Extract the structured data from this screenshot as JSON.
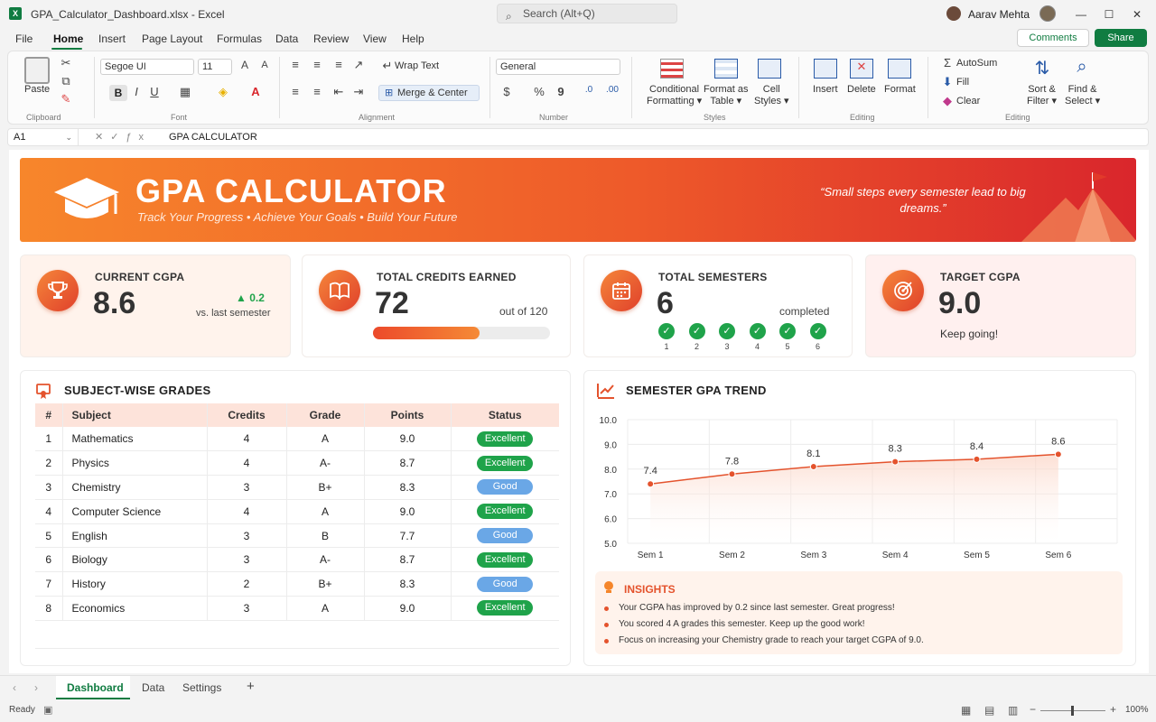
{
  "window": {
    "title": "GPA_Calculator_Dashboard.xlsx - Excel",
    "search_placeholder": "Search (Alt+Q)",
    "user": "Aarav Mehta"
  },
  "menu": {
    "items": [
      "File",
      "Home",
      "Insert",
      "Page Layout",
      "Formulas",
      "Data",
      "Review",
      "View",
      "Help"
    ],
    "active": "Home",
    "comments": "Comments",
    "share": "Share"
  },
  "ribbon": {
    "clipboard": {
      "paste": "Paste",
      "label": "Clipboard"
    },
    "font": {
      "name": "Segoe UI",
      "size": "11",
      "label": "Font"
    },
    "alignment": {
      "wrap": "Wrap Text",
      "merge": "Merge & Center",
      "label": "Alignment"
    },
    "number": {
      "format": "General",
      "label": "Number"
    },
    "styles": {
      "conditional": [
        "Conditional",
        "Formatting ▾"
      ],
      "format_table": [
        "Format as",
        "Table ▾"
      ],
      "cell_styles": [
        "Cell",
        "Styles ▾"
      ],
      "label": "Styles"
    },
    "cells": {
      "insert": "Insert",
      "delete": "Delete",
      "format": "Format",
      "label": "Editing"
    },
    "editing": {
      "autosum": "AutoSum",
      "fill": "Fill",
      "clear": "Clear",
      "sort": [
        "Sort &",
        "Filter ▾"
      ],
      "find": [
        "Find &",
        "Select ▾"
      ],
      "label": "Editing"
    }
  },
  "formula_bar": {
    "cell": "A1",
    "content": "GPA CALCULATOR"
  },
  "banner": {
    "title": "GPA CALCULATOR",
    "subtitle": "Track Your Progress  •  Achieve Your Goals  •  Build Your Future",
    "quote": "“Small steps every semester lead to big dreams.”"
  },
  "cards": {
    "cgpa": {
      "title": "CURRENT CGPA",
      "value": "8.6",
      "delta": "▲ 0.2",
      "delta_note": "vs. last semester",
      "icon": "trophy-icon"
    },
    "credits": {
      "title": "TOTAL CREDITS EARNED",
      "value": "72",
      "note": "out of 120",
      "progress": 0.6,
      "icon": "book-icon"
    },
    "semesters": {
      "title": "TOTAL SEMESTERS",
      "value": "6",
      "note": "completed",
      "steps": [
        "1",
        "2",
        "3",
        "4",
        "5",
        "6"
      ],
      "icon": "calendar-icon"
    },
    "target": {
      "title": "TARGET CGPA",
      "value": "9.0",
      "note": "Keep going!",
      "icon": "target-icon"
    }
  },
  "grades": {
    "title": "SUBJECT-WISE GRADES",
    "headers": [
      "#",
      "Subject",
      "Credits",
      "Grade",
      "Points",
      "Status"
    ],
    "rows": [
      [
        "1",
        "Mathematics",
        "4",
        "A",
        "9.0",
        "Excellent"
      ],
      [
        "2",
        "Physics",
        "4",
        "A-",
        "8.7",
        "Excellent"
      ],
      [
        "3",
        "Chemistry",
        "3",
        "B+",
        "8.3",
        "Good"
      ],
      [
        "4",
        "Computer Science",
        "4",
        "A",
        "9.0",
        "Excellent"
      ],
      [
        "5",
        "English",
        "3",
        "B",
        "7.7",
        "Good"
      ],
      [
        "6",
        "Biology",
        "3",
        "A-",
        "8.7",
        "Excellent"
      ],
      [
        "7",
        "History",
        "2",
        "B+",
        "8.3",
        "Good"
      ],
      [
        "8",
        "Economics",
        "3",
        "A",
        "9.0",
        "Excellent"
      ]
    ]
  },
  "status_colors": {
    "Excellent": "#1fa34a",
    "Good": "#6aa7e6"
  },
  "chart_data": {
    "type": "line",
    "title": "SEMESTER GPA TREND",
    "categories": [
      "Sem 1",
      "Sem 2",
      "Sem 3",
      "Sem 4",
      "Sem 5",
      "Sem 6"
    ],
    "values": [
      7.4,
      7.8,
      8.1,
      8.3,
      8.4,
      8.6
    ],
    "ylim": [
      5.0,
      10.0
    ],
    "yticks": [
      "10.0",
      "9.0",
      "8.0",
      "7.0",
      "6.0",
      "5.0"
    ],
    "color": "#e4532d",
    "grid": true
  },
  "insights": {
    "title": "INSIGHTS",
    "items": [
      "Your CGPA has improved by 0.2 since last semester. Great progress!",
      "You scored 4 A grades this semester. Keep up the good work!",
      "Focus on increasing your Chemistry grade to reach your target CGPA of 9.0."
    ]
  },
  "tabs": {
    "items": [
      "Dashboard",
      "Data",
      "Settings"
    ],
    "active": "Dashboard"
  },
  "status": {
    "ready": "Ready",
    "zoom": "100%"
  }
}
